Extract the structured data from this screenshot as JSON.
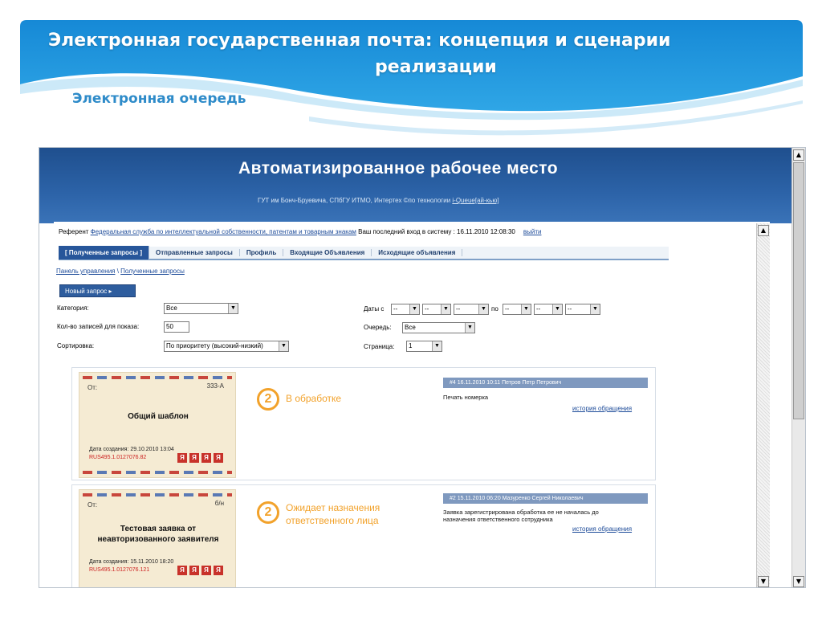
{
  "slide": {
    "title_line1": "Электронная государственная почта: концепция и сценарии",
    "title_line2": "реализации",
    "subtitle": "Электронная очередь"
  },
  "app": {
    "title": "Автоматизированное рабочее место",
    "credits": "ГУТ им Бонч-Бруевича, СПбГУ ИТМО, Интертех ©по технологии ",
    "credits_link": "i-Queue[ай-кью]"
  },
  "user_bar": {
    "prefix": "Референт ",
    "org_link": "Федеральная служба по интеллектуальной собственности, патентам и товарным знакам",
    "last_login": " Ваш последний вход в систему : 16.11.2010 12:08:30",
    "exit": "выйти"
  },
  "tabs": [
    {
      "label": "[ Полученные запросы ]"
    },
    {
      "label": "Отправленные запросы"
    },
    {
      "label": "Профиль"
    },
    {
      "label": "Входящие Объявления"
    },
    {
      "label": "Исходящие объявления"
    }
  ],
  "breadcrumb": {
    "root": "Панель управления",
    "sep": " \\ ",
    "current": "Полученные запросы"
  },
  "new_request": "Новый запрос",
  "filters": {
    "category_label": "Категория:",
    "category_value": "Все",
    "count_label": "Кол-во записей для показа:",
    "count_value": "50",
    "sort_label": "Сортировка:",
    "sort_value": "По приоритету (высокий-низкий)",
    "dates_label": "Даты с",
    "dates_to": "по",
    "date_dash": "--",
    "queue_label": "Очередь:",
    "queue_value": "Все",
    "page_label": "Страница:",
    "page_value": "1"
  },
  "cards": [
    {
      "from": "От:",
      "code": "333-А",
      "title_line1": "Общий шаблон",
      "title_line2": "",
      "created": "Дата создания: 29.10.2010 13:04",
      "id": "RUS495.1.0127076.82",
      "step": "2",
      "status_line1": "В обработке",
      "status_line2": "",
      "info_header": "#4   16.11.2010 10:11   Петров Петр Петрович",
      "info_text_line1": "Печать номерка",
      "info_text_line2": "",
      "history": "история обращения"
    },
    {
      "from": "От:",
      "code": "б/н",
      "title_line1": "Тестовая заявка от",
      "title_line2": "неавторизованного заявителя",
      "created": "Дата создания: 15.11.2010 18:20",
      "id": "RUS495.1.0127076.121",
      "step": "2",
      "status_line1": "Ожидает назначения",
      "status_line2": "ответственного лица",
      "info_header": "#2   15.11.2010 06:20   Мазуренко Сергей Николаевич",
      "info_text_line1": "Заявка зарегистрирована обработка ее не началась до",
      "info_text_line2": "назначения ответственного сотрудника",
      "history": "история обращения"
    }
  ],
  "stamp_glyph": "Я",
  "colors": {
    "accent": "#2e8bc9",
    "app_header": "#2c63a8",
    "status": "#f2a22b",
    "stamp": "#c8322a"
  }
}
